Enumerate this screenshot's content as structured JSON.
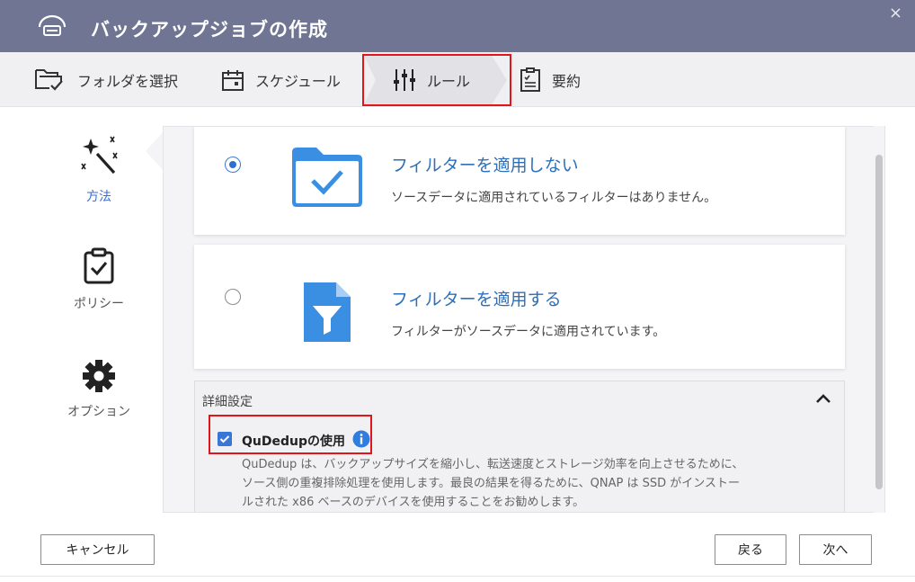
{
  "window": {
    "title": "バックアップジョブの作成",
    "close_glyph": "×"
  },
  "steps": [
    {
      "label": "フォルダを選択",
      "icon": "folder-check-icon"
    },
    {
      "label": "スケジュール",
      "icon": "calendar-icon"
    },
    {
      "label": "ルール",
      "icon": "sliders-icon",
      "active": true
    },
    {
      "label": "要約",
      "icon": "clipboard-list-icon"
    }
  ],
  "leftnav": [
    {
      "label": "方法",
      "icon": "magic-wand-icon",
      "active": true
    },
    {
      "label": "ポリシー",
      "icon": "clipboard-check-icon"
    },
    {
      "label": "オプション",
      "icon": "gear-icon"
    }
  ],
  "options": [
    {
      "title": "フィルターを適用しない",
      "desc": "ソースデータに適用されているフィルターはありません。",
      "selected": true,
      "icon": "folder-check-icon"
    },
    {
      "title": "フィルターを適用する",
      "desc": "フィルターがソースデータに適用されています。",
      "selected": false,
      "icon": "file-filter-icon"
    }
  ],
  "advanced": {
    "title": "詳細設定",
    "qudedup_label": "QuDedupの使用",
    "qudedup_checked": true,
    "desc_lines": [
      "QuDedup は、バックアップサイズを縮小し、転送速度とストレージ効率を向上させるために、",
      "ソース側の重複排除処理を使用します。最良の結果を得るために、QNAP は SSD がインストー",
      "ルされた x86 ベースのデバイスを使用することをお勧めします。"
    ]
  },
  "footer": {
    "cancel_label": "キャンセル",
    "back_label": "戻る",
    "next_label": "次へ"
  },
  "colors": {
    "titlebar": "#6f7592",
    "accent": "#2f6fd3",
    "highlight": "#e0161b"
  }
}
